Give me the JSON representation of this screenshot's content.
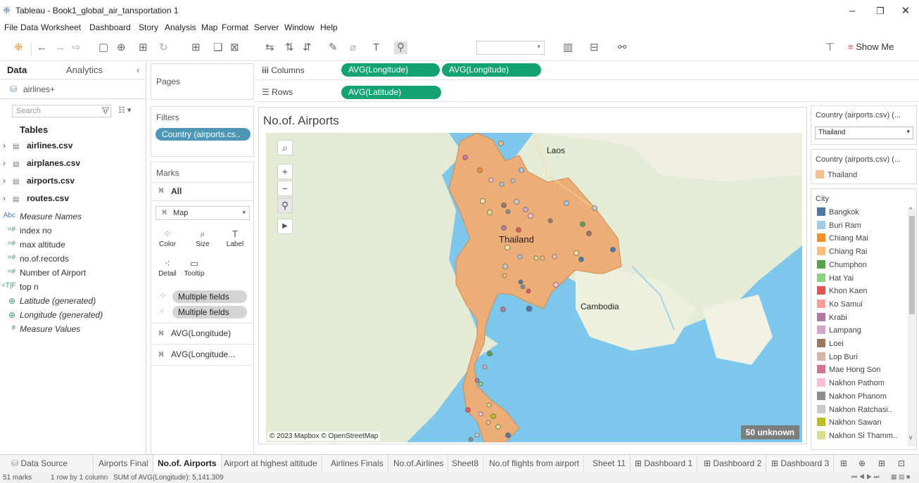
{
  "window": {
    "title": "Tableau - Book1_global_air_tansportation 1"
  },
  "menu": [
    "File",
    "Data",
    "Worksheet",
    "Dashboard",
    "Story",
    "Analysis",
    "Map",
    "Format",
    "Server",
    "Window",
    "Help"
  ],
  "toolbar": {
    "show_me": "Show Me"
  },
  "data_pane": {
    "tab_data": "Data",
    "tab_analytics": "Analytics",
    "datasource": "airlines+",
    "search_placeholder": "Search",
    "tables_header": "Tables",
    "tables": [
      "airlines.csv",
      "airplanes.csv",
      "airports.csv",
      "routes.csv"
    ],
    "fields": [
      {
        "type": "Abc",
        "name": "Measure Names",
        "italic": true
      },
      {
        "type": "=#",
        "name": "index no",
        "italic": false
      },
      {
        "type": "=#",
        "name": "max altitude",
        "italic": false
      },
      {
        "type": "=#",
        "name": "no.of.records",
        "italic": false
      },
      {
        "type": "=#",
        "name": "Number of Airport",
        "italic": false
      },
      {
        "type": "=T|F",
        "name": "top n",
        "italic": false
      },
      {
        "type": "⊕",
        "name": "Latitude (generated)",
        "italic": true
      },
      {
        "type": "⊕",
        "name": "Longitude (generated)",
        "italic": true
      },
      {
        "type": "#",
        "name": "Measure Values",
        "italic": true
      }
    ]
  },
  "cards": {
    "pages": "Pages",
    "filters": "Filters",
    "filter_pill": "Country (airports.cs..",
    "marks": "Marks",
    "marks_all": "All",
    "mark_type": "Map",
    "mark_buttons": [
      "Color",
      "Size",
      "Label",
      "Detail",
      "Tooltip"
    ],
    "mark_pills": [
      "Multiple fields",
      "Multiple fields"
    ],
    "mark_sections": [
      "AVG(Longitude)",
      "AVG(Longitude..."
    ]
  },
  "shelves": {
    "columns_label": "Columns",
    "columns": [
      "AVG(Longitude)",
      "AVG(Longitude)"
    ],
    "rows_label": "Rows",
    "rows": [
      "AVG(Latitude)"
    ]
  },
  "viz": {
    "title": "No.of. Airports",
    "labels": [
      "Laos",
      "Thailand",
      "Cambodia"
    ],
    "attribution": "© 2023 Mapbox © OpenStreetMap",
    "unknown": "50 unknown"
  },
  "right_pane": {
    "filter_title": "Country (airports.csv) (...",
    "filter_value": "Thailand",
    "legend1_title": "Country (airports.csv) (...",
    "legend1_item": "Thailand",
    "legend1_color": "#f7bf8f",
    "legend2_title": "City",
    "cities": [
      {
        "name": "Bangkok",
        "color": "#4e79a7"
      },
      {
        "name": "Buri Ram",
        "color": "#a0cbe8"
      },
      {
        "name": "Chiang Mai",
        "color": "#f28e2b"
      },
      {
        "name": "Chiang Rai",
        "color": "#ffbe7d"
      },
      {
        "name": "Chumphon",
        "color": "#59a14f"
      },
      {
        "name": "Hat Yai",
        "color": "#8cd17d"
      },
      {
        "name": "Khon Kaen",
        "color": "#e15759"
      },
      {
        "name": "Ko Samui",
        "color": "#ff9d9a"
      },
      {
        "name": "Krabi",
        "color": "#b07aa1"
      },
      {
        "name": "Lampang",
        "color": "#d4a6c8"
      },
      {
        "name": "Loei",
        "color": "#9d7660"
      },
      {
        "name": "Lop Buri",
        "color": "#d7b5a6"
      },
      {
        "name": "Mae Hong Son",
        "color": "#d37295"
      },
      {
        "name": "Nakhon Pathom",
        "color": "#fabfd2"
      },
      {
        "name": "Nakhon Phanom",
        "color": "#8e8e8e"
      },
      {
        "name": "Nakhon Ratchasi..",
        "color": "#c9c9c9"
      },
      {
        "name": "Nakhon Sawan",
        "color": "#bcbd22"
      },
      {
        "name": "Nakhon Si Thamm..",
        "color": "#dbdb8d"
      }
    ]
  },
  "sheet_tabs": {
    "data_source": "Data Source",
    "tabs": [
      "Airports Final",
      "No.of. Airports",
      "Airport at highest altitude",
      "Airlines Finals",
      "No.of.Airlines",
      "Sheet8",
      "No.of flights from airport",
      "Sheet 11",
      "Dashboard 1",
      "Dashboard 2",
      "Dashboard 3"
    ]
  },
  "status": {
    "marks": "51 marks",
    "rows": "1 row by 1 column",
    "sum": "SUM of AVG(Longitude): 5,141.309"
  }
}
